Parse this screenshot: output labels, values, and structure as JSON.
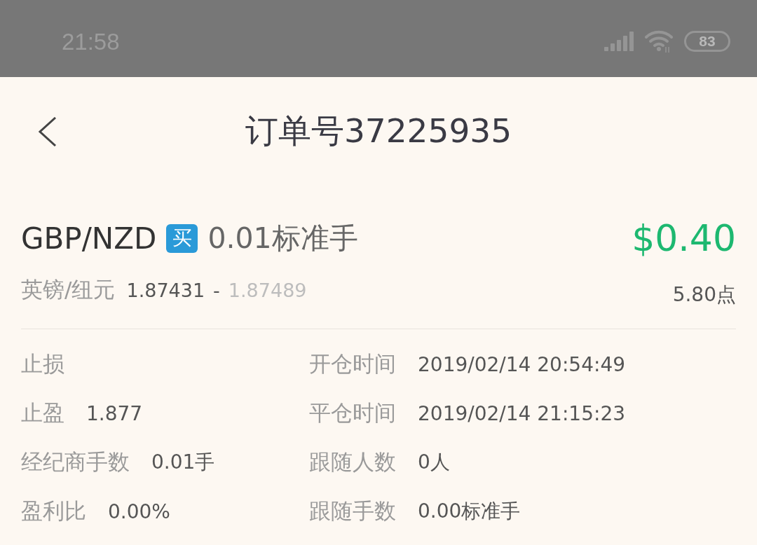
{
  "status_bar": {
    "time": "21:58",
    "battery": "83"
  },
  "header": {
    "title": "订单号37225935"
  },
  "order": {
    "symbol": "GBP/NZD",
    "side": {
      "kind": "buy",
      "label": "买"
    },
    "volume": "0.01标准手",
    "profit": "$0.40",
    "pair_name": "英镑/纽元",
    "bid": "1.87431",
    "separator": "-",
    "ask": "1.87489",
    "points": "5.80点"
  },
  "details": [
    {
      "label": "止损"
    },
    {
      "label": "开仓时间",
      "value": "2019/02/14 20:54:49"
    },
    {
      "label": "止盈",
      "value": "1.877"
    },
    {
      "label": "平仓时间",
      "value": "2019/02/14 21:15:23"
    },
    {
      "label": "经纪商手数",
      "value": "0.01手"
    },
    {
      "label": "跟随人数",
      "value": "0人"
    },
    {
      "label": "盈利比",
      "value": "0.00%"
    },
    {
      "label": "跟随手数",
      "value": "0.00标准手"
    }
  ]
}
